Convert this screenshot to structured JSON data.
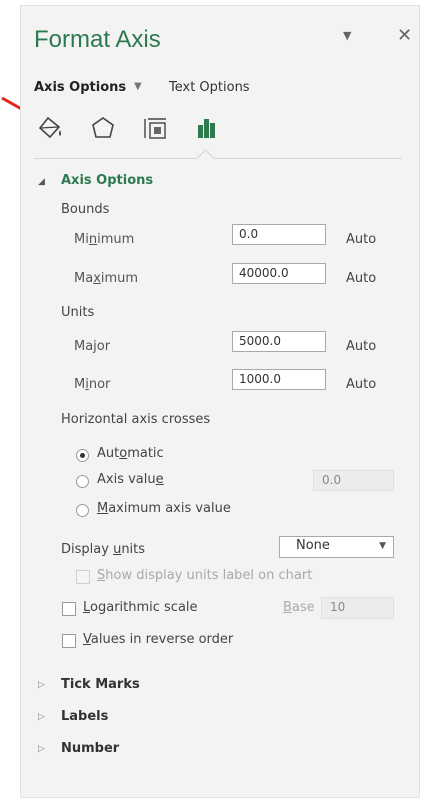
{
  "pane": {
    "title": "Format Axis",
    "dropdown_glyph": "▼",
    "close_glyph": "✕"
  },
  "tabs": {
    "axis_options": "Axis Options",
    "caret": "▼",
    "text_options": "Text Options"
  },
  "icons": [
    "fill-line-icon",
    "effects-icon",
    "size-properties-icon",
    "axis-options-icon"
  ],
  "colors": {
    "accent": "#2e7a4f",
    "annotation_arrow": "#e8231f"
  },
  "axis_options": {
    "title": "Axis Options",
    "caret": "◢",
    "bounds_label": "Bounds",
    "minimum": {
      "pre": "Mi",
      "u": "n",
      "post": "imum",
      "value": "0.0",
      "auto": "Auto"
    },
    "maximum": {
      "pre": "Ma",
      "u": "x",
      "post": "imum",
      "value": "40000.0",
      "auto": "Auto"
    },
    "units_label": "Units",
    "major": {
      "label": "Major",
      "value": "5000.0",
      "auto": "Auto"
    },
    "minor": {
      "pre": "M",
      "u": "i",
      "post": "nor",
      "value": "1000.0",
      "auto": "Auto"
    },
    "crosses_label": "Horizontal axis crosses",
    "automatic": {
      "pre": "Aut",
      "u": "o",
      "post": "matic",
      "checked": true
    },
    "axis_value": {
      "pre": "Axis valu",
      "u": "e",
      "post": "",
      "value": "0.0",
      "checked": false
    },
    "max_axis_value": {
      "pre": "",
      "u": "M",
      "post": "aximum axis value",
      "checked": false
    },
    "display_units": {
      "pre": "Display ",
      "u": "u",
      "post": "nits",
      "value": "None",
      "arrow": "▼"
    },
    "show_units_label": {
      "pre": "",
      "u": "S",
      "post": "how display units label on chart",
      "checked": false
    },
    "log_scale": {
      "pre": "",
      "u": "L",
      "post": "ogarithmic scale",
      "checked": false
    },
    "base": {
      "pre": "",
      "u": "B",
      "post": "ase",
      "value": "10"
    },
    "reverse": {
      "pre": "",
      "u": "V",
      "post": "alues in reverse order",
      "checked": false
    }
  },
  "collapsed_sections": [
    {
      "caret": "▷",
      "title": "Tick Marks"
    },
    {
      "caret": "▷",
      "title": "Labels"
    },
    {
      "caret": "▷",
      "title": "Number"
    }
  ]
}
